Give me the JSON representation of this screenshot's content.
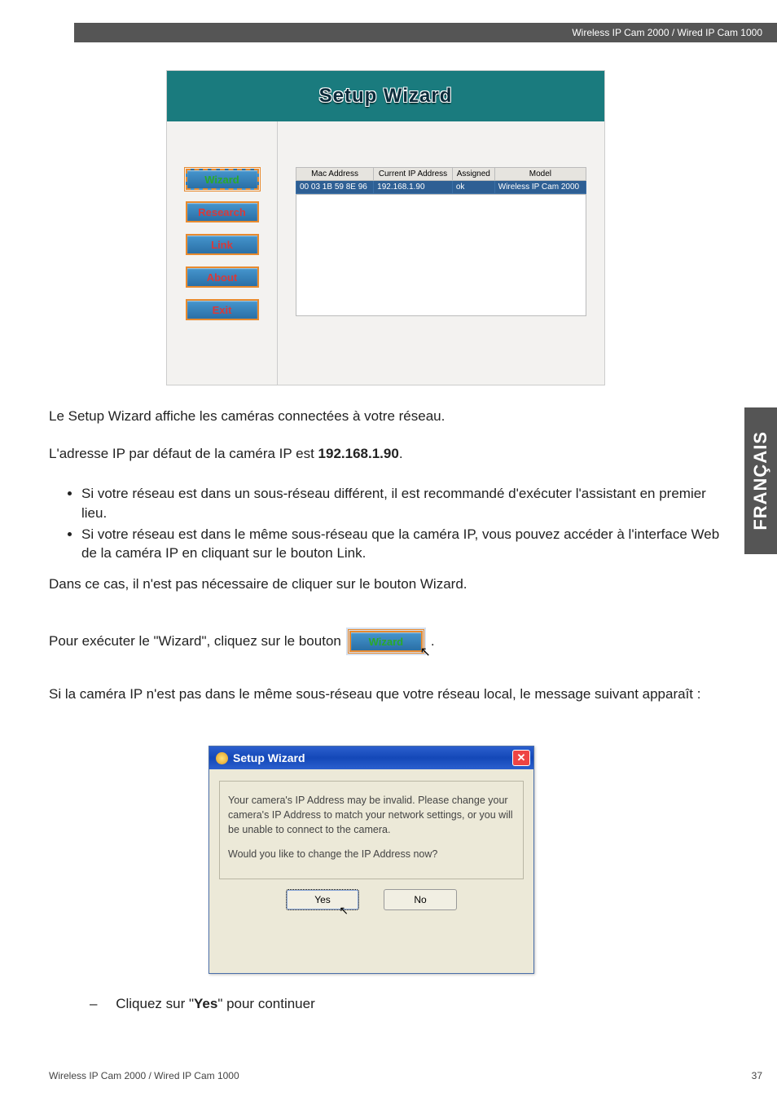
{
  "header": {
    "product": "Wireless IP Cam 2000 / Wired IP Cam 1000"
  },
  "side_tab": "FRANÇAIS",
  "shot1": {
    "title": "Setup Wizard",
    "buttons": {
      "wizard": "Wizard",
      "research": "Research",
      "link": "Link",
      "about": "About",
      "exit": "Exit"
    },
    "columns": {
      "mac": "Mac Address",
      "ip": "Current IP Address",
      "assigned": "Assigned",
      "model": "Model"
    },
    "row": {
      "mac": "00 03 1B 59 8E 96",
      "ip": "192.168.1.90",
      "assigned": "ok",
      "model": "Wireless IP Cam 2000"
    }
  },
  "body": {
    "p1": "Le Setup Wizard affiche les caméras connectées à votre réseau.",
    "p2_a": "L'adresse IP par défaut de la caméra IP est ",
    "p2_b": "192.168.1.90",
    "p2_c": ".",
    "li1": "Si votre réseau est dans un sous-réseau différent, il est recommandé d'exécuter l'assistant en premier lieu.",
    "li2": "Si votre réseau est dans le même sous-réseau que la caméra IP, vous pouvez accéder à l'interface Web de la caméra IP en cliquant sur le bouton Link.",
    "p3": "Dans ce cas, il n'est pas nécessaire de cliquer sur le bouton Wizard.",
    "p4_a": "Pour exécuter le \"Wizard\", cliquez sur le bouton ",
    "p4_b": ".",
    "inline_btn": "Wizard",
    "p5": "Si la caméra IP n'est pas dans le même sous-réseau que votre réseau local, le message suivant apparaît :"
  },
  "shot2": {
    "title": "Setup Wizard",
    "msg1": "Your camera's IP Address may be invalid. Please change your camera's IP Address to match your network settings, or you will be unable to connect to the camera.",
    "msg2": "Would you like to change the IP Address now?",
    "yes": "Yes",
    "no": "No",
    "close_glyph": "✕"
  },
  "final": {
    "dash": "–",
    "a": "Cliquez sur \"",
    "b": "Yes",
    "c": "\" pour continuer"
  },
  "footer": {
    "left": "Wireless IP Cam 2000 / Wired IP Cam 1000",
    "page": "37"
  },
  "cursor_glyph": "↖"
}
